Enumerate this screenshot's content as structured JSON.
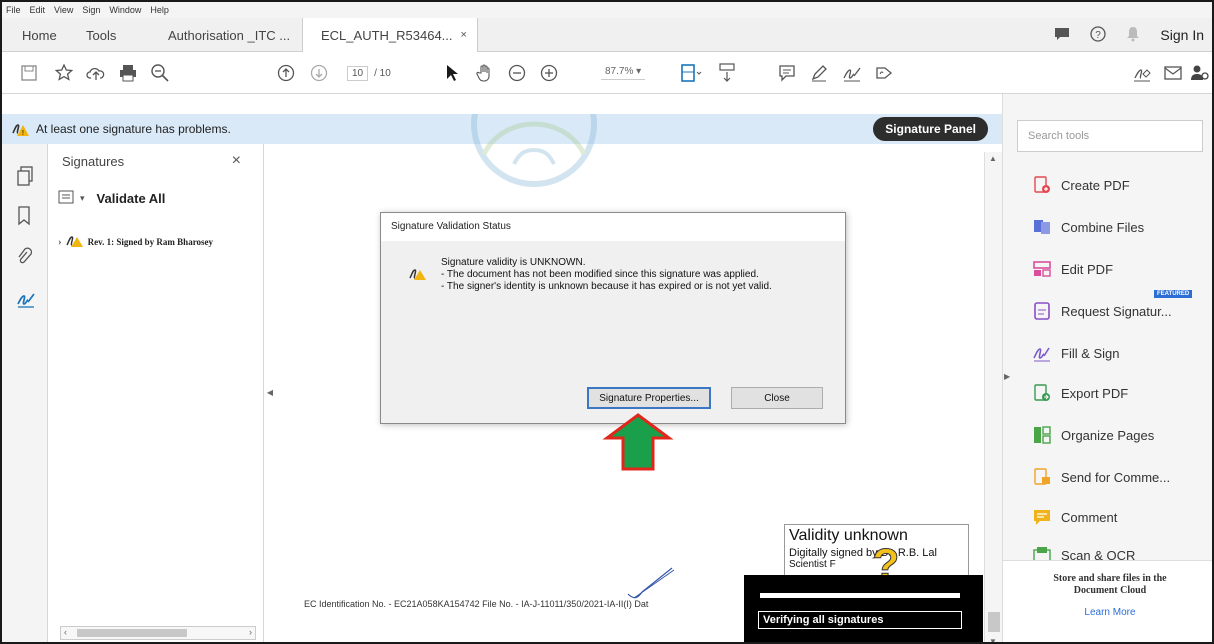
{
  "menubar": [
    "File",
    "Edit",
    "View",
    "Sign",
    "Window",
    "Help"
  ],
  "tabs": {
    "home": "Home",
    "tools": "Tools",
    "doc1": "Authorisation _ITC ...",
    "doc2": "ECL_AUTH_R53464...",
    "close": "×"
  },
  "header": {
    "signin": "Sign In"
  },
  "toolbar": {
    "page_current": "10",
    "page_total": "/ 10",
    "zoom": "87.7%"
  },
  "notification": {
    "message": "At least one signature has problems.",
    "button": "Signature Panel"
  },
  "signatures_panel": {
    "title": "Signatures",
    "close": "×",
    "validate_all": "Validate All",
    "signature_item": "Rev. 1: Signed by Ram Bharosey"
  },
  "dialog": {
    "title": "Signature Validation Status",
    "line1": "Signature validity is UNKNOWN.",
    "line2": "- The document has not been modified since this signature was applied.",
    "line3": "- The signer's identity is unknown because it has expired or is not yet valid.",
    "properties_button": "Signature Properties...",
    "close_button": "Close"
  },
  "document": {
    "footer": "EC Identification No. - EC21A058KA154742    File No. - IA-J-11011/350/2021-IA-II(I)    Dat",
    "validity_title": "Validity unknown",
    "validity_line2": "Digitally signed by Dr. R.B. Lal",
    "validity_line3": "Scientist F",
    "verifying": "Verifying all signatures"
  },
  "tools_panel": {
    "search_placeholder": "Search tools",
    "featured_badge": "FEATURED",
    "items": [
      {
        "label": "Create PDF",
        "color": "#e34850"
      },
      {
        "label": "Combine Files",
        "color": "#5b6fd8"
      },
      {
        "label": "Edit PDF",
        "color": "#d94f9c"
      },
      {
        "label": "Request Signatur...",
        "color": "#8a4ec7"
      },
      {
        "label": "Fill & Sign",
        "color": "#7b5bc9"
      },
      {
        "label": "Export PDF",
        "color": "#3a9a52"
      },
      {
        "label": "Organize Pages",
        "color": "#4aa548"
      },
      {
        "label": "Send for Comme...",
        "color": "#f0a428"
      },
      {
        "label": "Comment",
        "color": "#f1b31c"
      },
      {
        "label": "Scan & OCR",
        "color": "#4aa548"
      }
    ],
    "store_line1": "Store and share files in the",
    "store_line2": "Document Cloud",
    "learn_more": "Learn More"
  }
}
